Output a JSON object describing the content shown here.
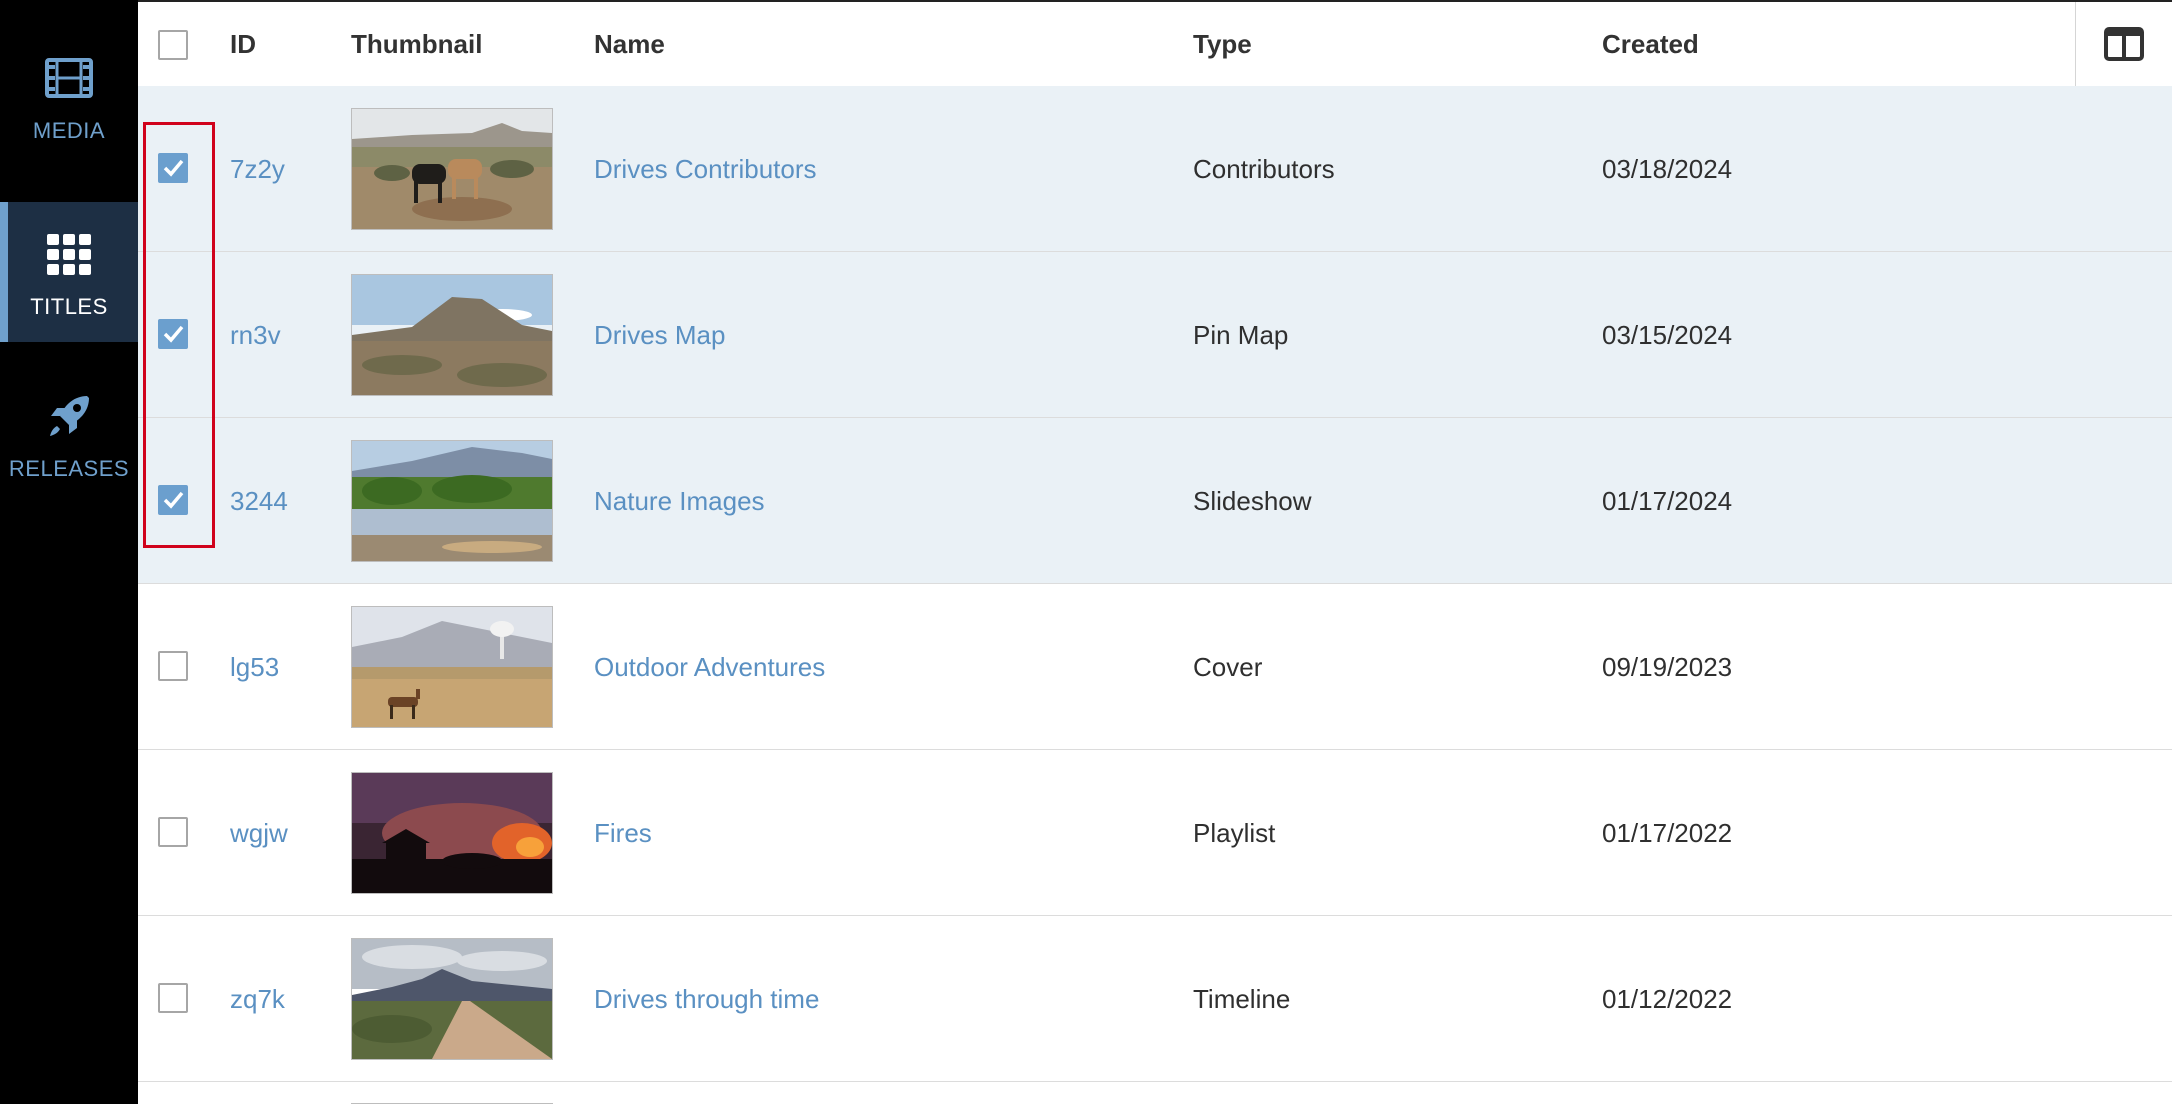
{
  "sidebar": {
    "items": [
      {
        "label": "MEDIA",
        "icon": "film-icon"
      },
      {
        "label": "TITLES",
        "icon": "grid-icon",
        "active": true
      },
      {
        "label": "RELEASES",
        "icon": "rocket-icon"
      }
    ]
  },
  "table": {
    "columns": {
      "id": "ID",
      "thumbnail": "Thumbnail",
      "name": "Name",
      "type": "Type",
      "created": "Created"
    },
    "rows": [
      {
        "id": "7z2y",
        "name": "Drives Contributors",
        "type": "Contributors",
        "created": "03/18/2024",
        "selected": true,
        "thumbnail": "desert-cattle"
      },
      {
        "id": "rn3v",
        "name": "Drives Map",
        "type": "Pin Map",
        "created": "03/15/2024",
        "selected": true,
        "thumbnail": "desert-hill"
      },
      {
        "id": "3244",
        "name": "Nature Images",
        "type": "Slideshow",
        "created": "01/17/2024",
        "selected": true,
        "thumbnail": "river-trees"
      },
      {
        "id": "lg53",
        "name": "Outdoor Adventures",
        "type": "Cover",
        "created": "09/19/2023",
        "selected": false,
        "thumbnail": "antelope-plains"
      },
      {
        "id": "wgjw",
        "name": "Fires",
        "type": "Playlist",
        "created": "01/17/2022",
        "selected": false,
        "thumbnail": "wildfire-sunset"
      },
      {
        "id": "zq7k",
        "name": "Drives through time",
        "type": "Timeline",
        "created": "01/12/2022",
        "selected": false,
        "thumbnail": "dirt-road-mountains"
      }
    ]
  },
  "colors": {
    "sidebar_bg": "#000000",
    "accent": "#6fa0cc",
    "link": "#5a90c2",
    "selected_row": "#eaf1f6",
    "highlight": "#d0021b"
  }
}
